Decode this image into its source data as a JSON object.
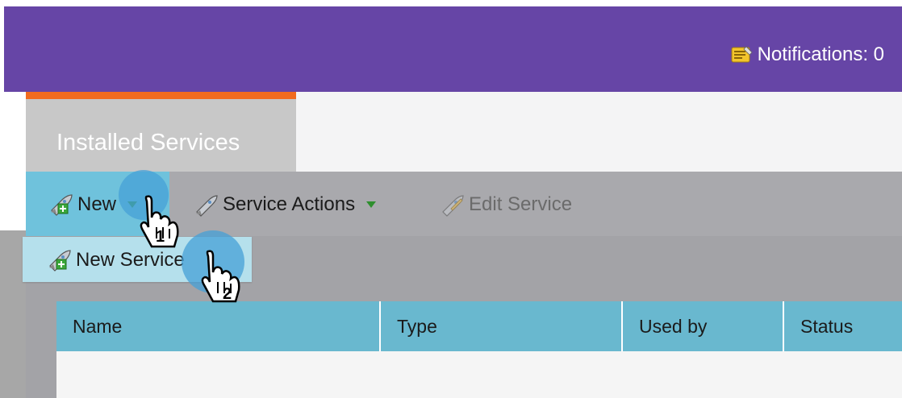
{
  "header": {
    "notifications_label": "Notifications: 0",
    "icon": "notepad-icon"
  },
  "tabs": [
    {
      "label": "Installed Services",
      "active": true
    }
  ],
  "toolbar": {
    "new_label": "New",
    "service_actions_label": "Service Actions",
    "edit_service_label": "Edit Service"
  },
  "dropdown": {
    "items": [
      {
        "label": "New Service",
        "icon": "rocket-plus-icon"
      }
    ]
  },
  "table": {
    "columns": [
      "Name",
      "Type",
      "Used by",
      "Status"
    ]
  },
  "annotations": {
    "step1": "1",
    "step2": "2"
  },
  "colors": {
    "header": "#6645a6",
    "tab_accent": "#f16b1f",
    "table_header": "#69b8cf",
    "highlight": "#6fc2dc"
  }
}
